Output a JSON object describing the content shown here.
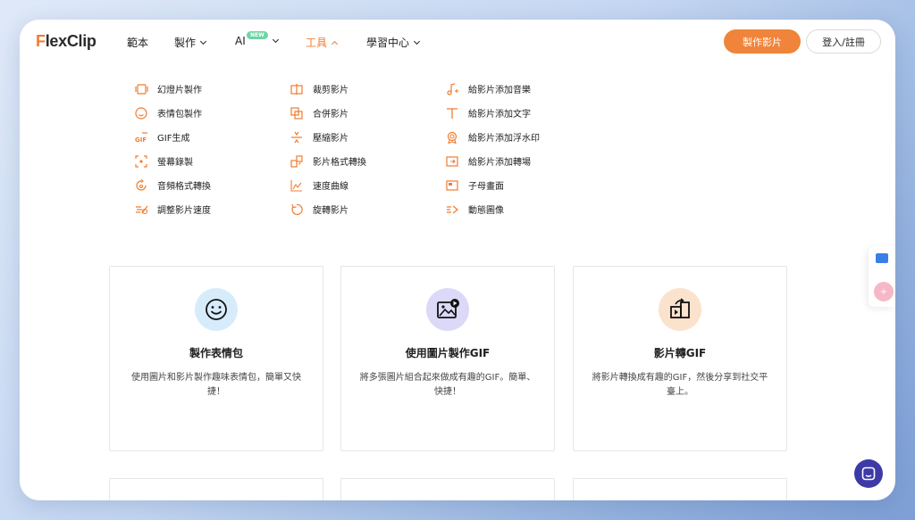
{
  "header": {
    "logo": {
      "first": "F",
      "rest": "lexClip"
    },
    "nav": [
      {
        "label": "範本"
      },
      {
        "label": "製作"
      },
      {
        "label": "AI",
        "badge": "NEW"
      },
      {
        "label": "工具"
      },
      {
        "label": "學習中心"
      }
    ],
    "primary_button": "製作影片",
    "login_button": "登入/註冊"
  },
  "menu": {
    "col1": [
      {
        "label": "幻燈片製作",
        "icon": "slideshow-icon"
      },
      {
        "label": "表情包製作",
        "icon": "smiley-icon"
      },
      {
        "label": "GIF生成",
        "icon": "gif-icon"
      },
      {
        "label": "螢幕錄製",
        "icon": "screen-record-icon"
      },
      {
        "label": "音頻格式轉換",
        "icon": "audio-convert-icon"
      },
      {
        "label": "調整影片速度",
        "icon": "speed-icon"
      }
    ],
    "col2": [
      {
        "label": "裁剪影片",
        "icon": "crop-icon"
      },
      {
        "label": "合併影片",
        "icon": "merge-icon"
      },
      {
        "label": "壓縮影片",
        "icon": "compress-icon"
      },
      {
        "label": "影片格式轉換",
        "icon": "video-convert-icon"
      },
      {
        "label": "速度曲線",
        "icon": "speed-curve-icon"
      },
      {
        "label": "旋轉影片",
        "icon": "rotate-icon"
      }
    ],
    "col3": [
      {
        "label": "給影片添加音樂",
        "icon": "music-note-icon"
      },
      {
        "label": "給影片添加文字",
        "icon": "text-icon"
      },
      {
        "label": "給影片添加浮水印",
        "icon": "watermark-icon"
      },
      {
        "label": "給影片添加轉場",
        "icon": "transition-icon"
      },
      {
        "label": "子母畫面",
        "icon": "picture-in-picture-icon"
      },
      {
        "label": "動態圖像",
        "icon": "motion-icon"
      }
    ]
  },
  "cards": [
    {
      "title": "製作表情包",
      "desc": "使用圖片和影片製作趣味表情包，簡單又快捷！",
      "circle_color": "#d7ecfb"
    },
    {
      "title": "使用圖片製作GIF",
      "desc": "將多張圖片組合起來做成有趣的GIF。簡單、快捷！",
      "circle_color": "#dcd8f7"
    },
    {
      "title": "影片轉GIF",
      "desc": "將影片轉換成有趣的GIF，然後分享到社交平臺上。",
      "circle_color": "#fbe2cc"
    }
  ],
  "colors": {
    "accent": "#f07c2f",
    "chat": "#3d3aa8"
  }
}
